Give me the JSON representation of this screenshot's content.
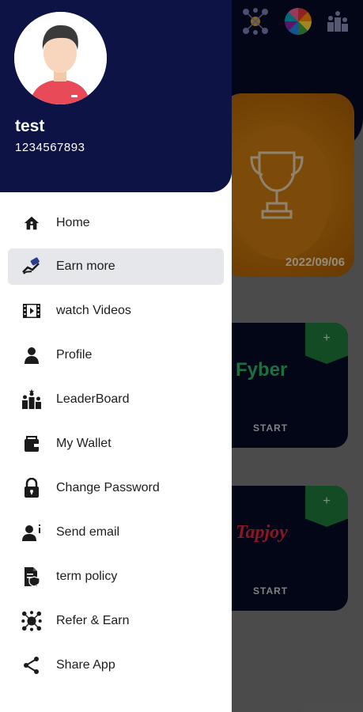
{
  "background": {
    "trophy_date": "2022/09/06",
    "offers": [
      {
        "logo": "Fyber",
        "action": "START",
        "tag": "+"
      },
      {
        "logo": "Tapjoy",
        "action": "START",
        "tag": "+"
      }
    ],
    "colors": {
      "navy": "#050a26",
      "green": "#1f7a3d",
      "orange": "#c77a10"
    }
  },
  "drawer": {
    "user": {
      "name": "test",
      "phone": "1234567893"
    },
    "colors": {
      "header": "#0d1445",
      "active_item": "#e6e7ea"
    },
    "menu": [
      {
        "label": "Home",
        "icon": "home-icon"
      },
      {
        "label": "Earn more",
        "icon": "earn-more-icon",
        "active": true
      },
      {
        "label": "watch Videos",
        "icon": "video-icon"
      },
      {
        "label": "Profile",
        "icon": "profile-icon"
      },
      {
        "label": "LeaderBoard",
        "icon": "leaderboard-icon"
      },
      {
        "label": "My Wallet",
        "icon": "wallet-icon"
      },
      {
        "label": "Change Password",
        "icon": "lock-icon"
      },
      {
        "label": "Send email",
        "icon": "send-email-icon"
      },
      {
        "label": "term policy",
        "icon": "policy-icon"
      },
      {
        "label": "Refer & Earn",
        "icon": "refer-icon"
      },
      {
        "label": "Share App",
        "icon": "share-icon"
      }
    ]
  }
}
